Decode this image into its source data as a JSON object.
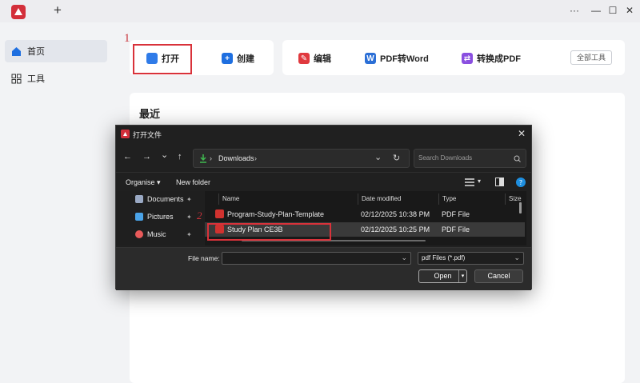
{
  "titlebar": {
    "new_tab": "+",
    "more": "···",
    "minimize": "—",
    "maximize": "☐",
    "close": "✕"
  },
  "sidebar": {
    "items": [
      {
        "label": "首页",
        "icon": "home-icon"
      },
      {
        "label": "工具",
        "icon": "grid-icon"
      }
    ]
  },
  "actions": {
    "open": "打开",
    "create": "创建",
    "edit": "编辑",
    "pdf_to_word": "PDF转Word",
    "convert_pdf": "转换成PDF",
    "all_tools": "全部工具"
  },
  "annotations": {
    "step1": "1",
    "step2": "2"
  },
  "recent": {
    "title": "最近"
  },
  "dialog": {
    "title": "打开文件",
    "close": "✕",
    "nav": {
      "back": "←",
      "forward": "→",
      "down": "⌄",
      "up": "↑",
      "refresh": "↻",
      "chevron": "⌄"
    },
    "address": {
      "path": "Downloads",
      "sep": "›"
    },
    "search_placeholder": "Search Downloads",
    "cmdbar": {
      "organise": "Organise ▾",
      "new_folder": "New folder"
    },
    "nav_pane": [
      {
        "label": "Documents"
      },
      {
        "label": "Pictures"
      },
      {
        "label": "Music"
      }
    ],
    "columns": {
      "name": "Name",
      "date": "Date modified",
      "type": "Type",
      "size": "Size"
    },
    "files": [
      {
        "name": "Program-Study-Plan-Template",
        "date": "02/12/2025 10:38 PM",
        "type": "PDF File"
      },
      {
        "name": "Study Plan CE3B",
        "date": "02/12/2025 10:25 PM",
        "type": "PDF File"
      }
    ],
    "filename_label": "File name:",
    "filename_value": "",
    "filter": "pdf Files (*.pdf)",
    "open_btn": "Open",
    "cancel_btn": "Cancel"
  },
  "colors": {
    "accent_red": "#d9323a",
    "blue": "#1e6fe0"
  }
}
